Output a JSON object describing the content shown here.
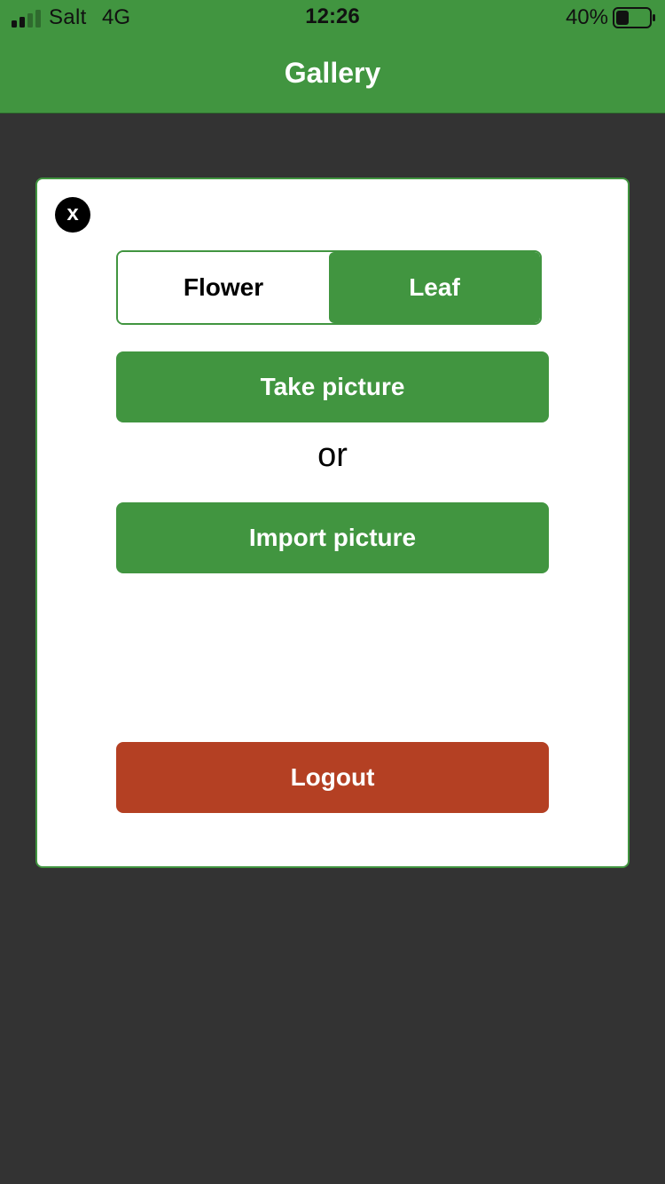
{
  "status_bar": {
    "carrier": "Salt",
    "network": "4G",
    "time": "12:26",
    "battery_percent": "40%",
    "battery_level": 0.4,
    "signal_bars_filled": 2,
    "signal_bars_total": 4
  },
  "header": {
    "title": "Gallery"
  },
  "modal": {
    "close_label": "x",
    "segments": {
      "flower": "Flower",
      "leaf": "Leaf",
      "selected": "Leaf"
    },
    "take_picture": "Take picture",
    "or_text": "or",
    "import_picture": "Import picture",
    "logout": "Logout"
  },
  "colors": {
    "primary_green": "#419540",
    "logout_red": "#b44023",
    "backdrop": "#333333"
  }
}
